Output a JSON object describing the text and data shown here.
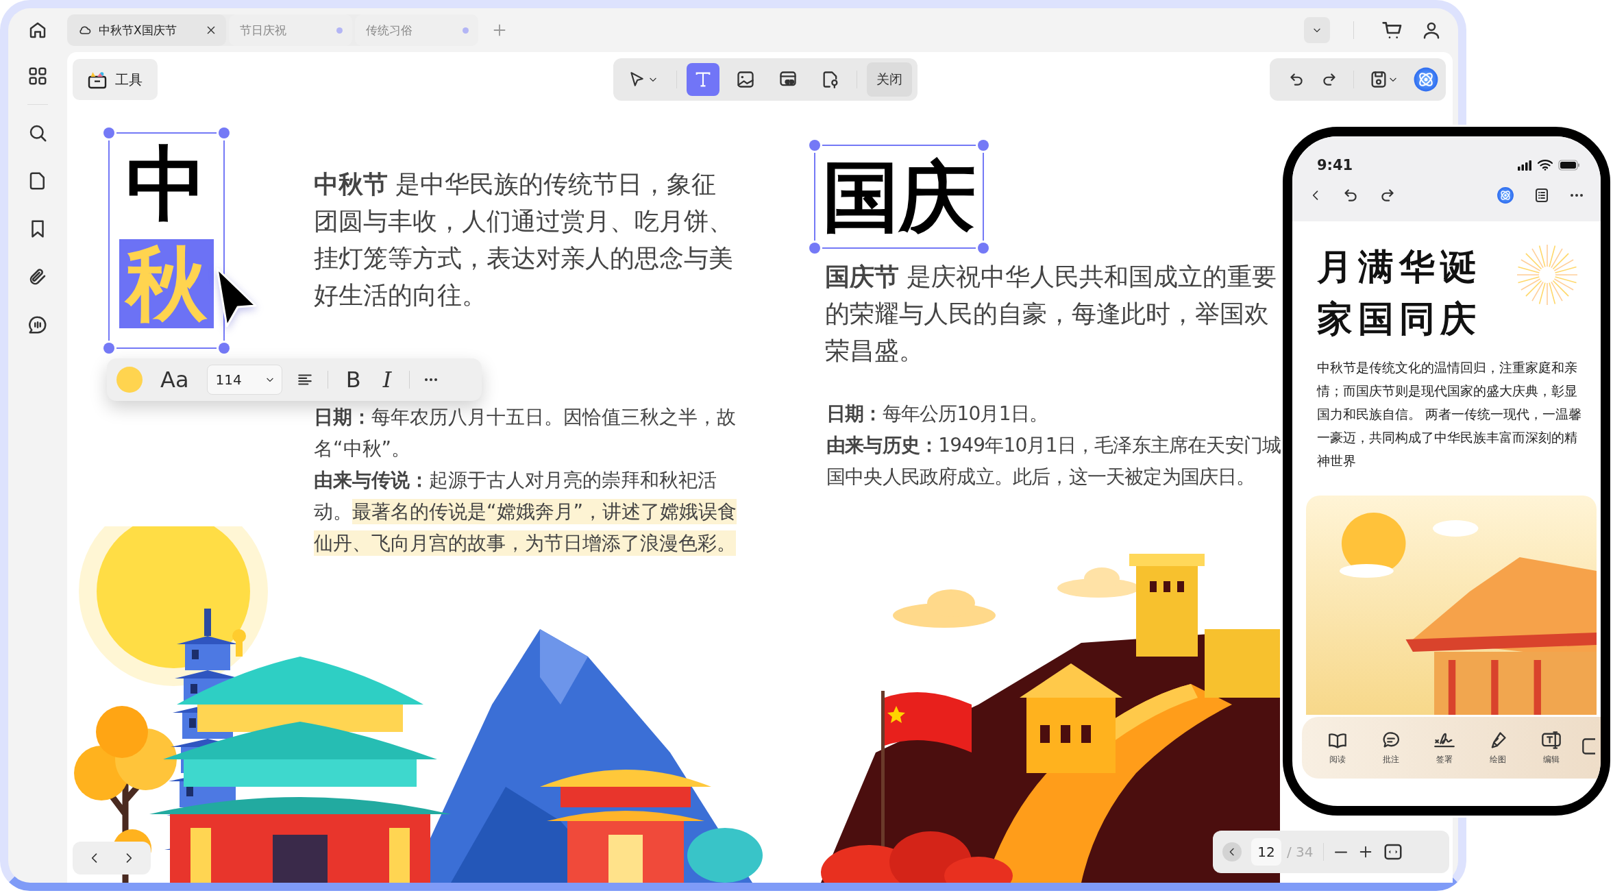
{
  "tabs": [
    {
      "label": "中秋节X国庆节",
      "selected": true,
      "modified": false
    },
    {
      "label": "节日庆祝",
      "selected": false,
      "modified": true
    },
    {
      "label": "传统习俗",
      "selected": false,
      "modified": true
    }
  ],
  "toolbar": {
    "tools_button": "工具",
    "tools": [
      {
        "kind": "select",
        "selected": false
      },
      {
        "kind": "text",
        "selected": true
      },
      {
        "kind": "image",
        "selected": false
      },
      {
        "kind": "link",
        "selected": false
      },
      {
        "kind": "stamp",
        "selected": false
      }
    ],
    "close": "关闭"
  },
  "mid_autumn": {
    "title_chars": [
      {
        "text": "中",
        "highlighted": false
      },
      {
        "text": "秋",
        "highlighted": true
      }
    ],
    "intro": "**中秋节** 是中华民族的传统节日，象征团圆与丰收，人们通过赏月、吃月饼、挂灯笼等方式，表达对亲人的思念与美好生活的向往。",
    "date": "**日期：**每年农历八月十五日。因恰值三秋之半，故名“中秋”。",
    "legend": [
      {
        "text": "**由来与传说：**起源于古人对月亮的崇拜和秋祀活动。",
        "highlighted": false
      },
      {
        "text": "最著名的传说是“嫦娥奔月”，讲述了嫦娥误食仙丹、飞向月宫的故事，为节日增添了浪漫色彩。",
        "highlighted": true
      }
    ]
  },
  "format_bar": {
    "color": "#ffd44f",
    "font_label": "Aa",
    "size": "114",
    "bold": "B",
    "italic": "I"
  },
  "national_day": {
    "title": "国庆",
    "intro_lines": [
      "**国庆节** 是庆祝中华人民共和国成立的重要",
      "的荣耀与人民的自豪，每逢此时，举国欢",
      "荣昌盛。"
    ],
    "date": "**日期：**每年公历10月1日。",
    "history_lines": [
      "**由来与历史：**1949年10月1日，毛泽东主席在天安门城",
      "国中央人民政府成立。此后，这一天被定为国庆日。"
    ]
  },
  "page_nav": {
    "page": "12",
    "total": "/ 34"
  },
  "phone": {
    "time": "9:41",
    "title_lines": [
      "月满华诞",
      "家国同庆"
    ],
    "text": "中秋节是传统文化的温情回归，注重家庭和亲情；而国庆节则是现代国家的盛大庆典，彰显国力和民族自信。 两者一传统一现代，一温馨一豪迈，共同构成了中华民族丰富而深刻的精神世界",
    "tools": [
      {
        "kind": "read",
        "label": "阅读"
      },
      {
        "kind": "comment",
        "label": "批注"
      },
      {
        "kind": "sign",
        "label": "签署"
      },
      {
        "kind": "draw",
        "label": "绘图"
      },
      {
        "kind": "edit",
        "label": "编辑"
      }
    ]
  }
}
